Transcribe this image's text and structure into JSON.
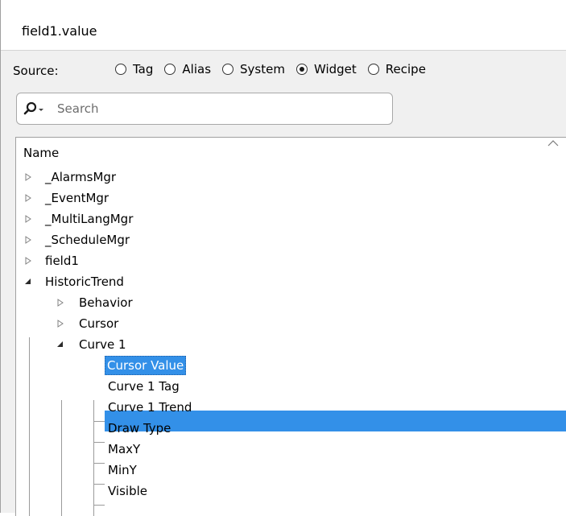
{
  "header": {
    "title": "field1.value"
  },
  "source": {
    "label": "Source:",
    "options": [
      {
        "label": "Tag",
        "checked": false
      },
      {
        "label": "Alias",
        "checked": false
      },
      {
        "label": "System",
        "checked": false
      },
      {
        "label": "Widget",
        "checked": true
      },
      {
        "label": "Recipe",
        "checked": false
      }
    ]
  },
  "search": {
    "placeholder": "Search",
    "value": ""
  },
  "tree": {
    "header": "Name",
    "items": [
      {
        "label": "_AlarmsMgr",
        "expander": "collapsed"
      },
      {
        "label": "_EventMgr",
        "expander": "collapsed"
      },
      {
        "label": "_MultiLangMgr",
        "expander": "collapsed"
      },
      {
        "label": "_ScheduleMgr",
        "expander": "collapsed"
      },
      {
        "label": "field1",
        "expander": "collapsed"
      },
      {
        "label": "HistoricTrend",
        "expander": "expanded"
      },
      {
        "label": "Behavior",
        "expander": "collapsed"
      },
      {
        "label": "Cursor",
        "expander": "collapsed"
      },
      {
        "label": "Curve 1",
        "expander": "expanded"
      },
      {
        "label": "Cursor Value",
        "selected": true
      },
      {
        "label": "Curve 1 Tag"
      },
      {
        "label": "Curve 1 Trend"
      },
      {
        "label": "Draw Type"
      },
      {
        "label": "MaxY"
      },
      {
        "label": "MinY"
      },
      {
        "label": "Visible"
      }
    ]
  },
  "colors": {
    "selection": "#3390e8",
    "panel": "#f0f0f0"
  }
}
